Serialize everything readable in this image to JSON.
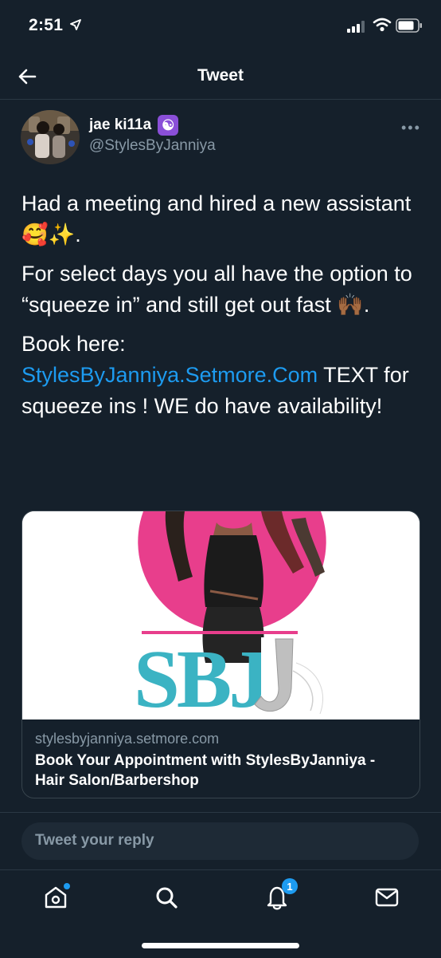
{
  "status_bar": {
    "time": "2:51",
    "icons": [
      "location-arrow-icon",
      "signal-icon",
      "wifi-icon",
      "battery-icon"
    ]
  },
  "nav": {
    "title": "Tweet",
    "back_icon": "back-arrow-icon"
  },
  "tweet": {
    "author_name": "jae ki11a",
    "author_badge": "☯",
    "handle": "@StylesByJanniya",
    "more_icon": "more-dots-icon",
    "paragraph1": "Had a meeting and hired a new assistant 🥰✨.",
    "paragraph2": "For select days you all have the option to “squeeze in” and still get out fast 🙌🏾.",
    "paragraph3_prefix": "Book here:",
    "link_text": "StylesByJanniya.Setmore.Com",
    "paragraph3_suffix": " TEXT for squeeze ins ! WE do have availability!"
  },
  "card": {
    "logo_text": "SBJ",
    "domain": "stylesbyjanniya.setmore.com",
    "title": "Book Your Appointment with StylesByJanniya - Hair Salon/Barbershop"
  },
  "reply": {
    "placeholder": "Tweet your reply"
  },
  "tab_bar": {
    "items": [
      "home-icon",
      "search-icon",
      "notifications-icon",
      "messages-icon"
    ],
    "notification_count": "1"
  },
  "colors": {
    "background": "#15202b",
    "accent": "#1d9bf0",
    "muted": "#8899a6"
  }
}
